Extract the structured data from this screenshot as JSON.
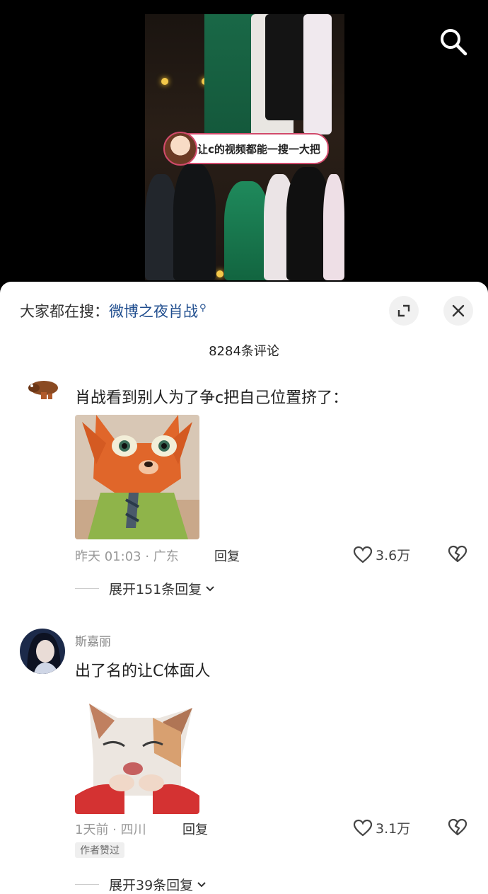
{
  "video": {
    "overlay_text": "让c的视频都能一搜一大把"
  },
  "header": {
    "trending_prefix": "大家都在搜：",
    "trending_topic": "微博之夜肖战",
    "comment_count": "8284条评论"
  },
  "comments": [
    {
      "username": "",
      "text": "肖战看到别人为了争c把自己位置挤了：",
      "time": "昨天 01:03 · 广东",
      "reply_label": "回复",
      "likes": "3.6万",
      "more_replies": "展开151条回复"
    },
    {
      "username": "斯嘉丽",
      "text": "出了名的让C体面人",
      "time": "1天前 · 四川",
      "reply_label": "回复",
      "likes": "3.1万",
      "badge": "作者赞过",
      "more_replies": "展开39条回复"
    }
  ],
  "icons": {
    "search": "search-icon",
    "expand": "expand-icon",
    "close": "close-icon",
    "like": "heart-icon",
    "dislike": "broken-heart-icon",
    "chevron": "chevron-down-icon"
  },
  "colors": {
    "topic_link": "#1f4d8e",
    "banner_border": "#d14a6b"
  }
}
